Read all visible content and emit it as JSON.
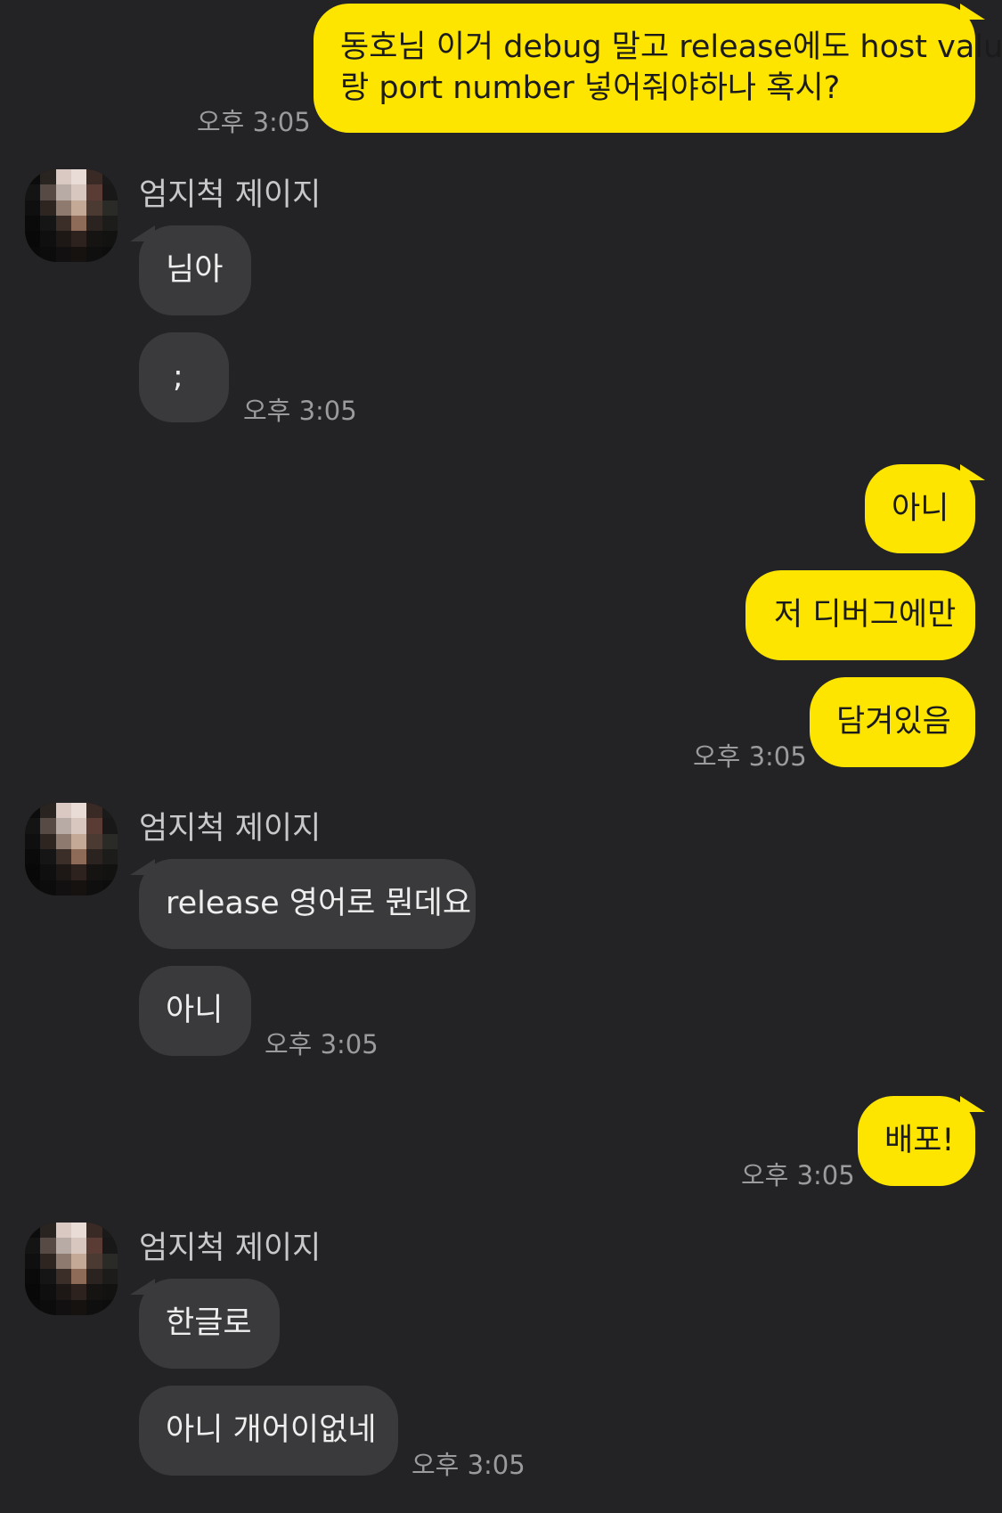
{
  "messages": [
    {
      "sender": "me",
      "lines": [
        "동호님 이거 debug 말고 release에도 host value",
        "랑 port number 넣어줘야하나 혹시?"
      ],
      "time": "오후 3:05"
    },
    {
      "sender": "other",
      "name": "엄지척 제이지",
      "texts": [
        "님아",
        ";"
      ],
      "time": "오후 3:05"
    },
    {
      "sender": "me",
      "texts": [
        "아니",
        "저 디버그에만",
        "담겨있음"
      ],
      "time": "오후 3:05"
    },
    {
      "sender": "other",
      "name": "엄지척 제이지",
      "texts": [
        "release 영어로 뭔데요",
        "아니"
      ],
      "time": "오후 3:05"
    },
    {
      "sender": "me",
      "texts": [
        "배포!"
      ],
      "time": "오후 3:05"
    },
    {
      "sender": "other",
      "name": "엄지척 제이지",
      "texts": [
        "한글로",
        "아니 개어이없네"
      ],
      "time": "오후 3:05"
    }
  ],
  "colors": {
    "background": "#232325",
    "my_bubble": "#fee500",
    "their_bubble": "#3a3a3c",
    "timestamp": "#9b9b9d"
  },
  "icons": {
    "avatar": "pixelated-profile-photo"
  }
}
